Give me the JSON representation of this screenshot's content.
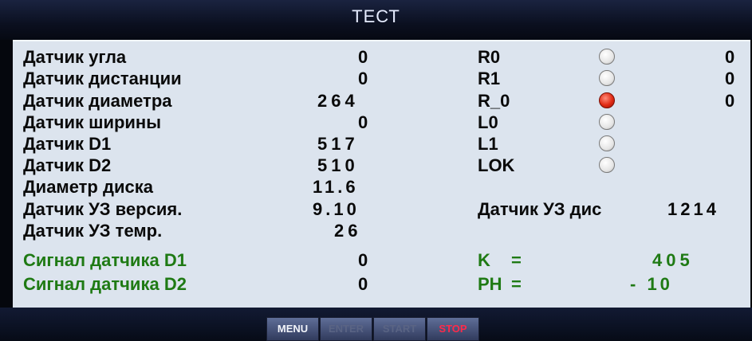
{
  "header": {
    "title": "ТЕСТ"
  },
  "sensors": [
    {
      "label": "Датчик угла",
      "value": "0"
    },
    {
      "label": "Датчик дистанции",
      "value": "0"
    },
    {
      "label": "Датчик диаметра",
      "value": "264"
    },
    {
      "label": "Датчик ширины",
      "value": "0"
    },
    {
      "label": "Датчик D1",
      "value": "517"
    },
    {
      "label": "Датчик D2",
      "value": "510"
    },
    {
      "label": "Диаметр диска",
      "value": "11.6"
    },
    {
      "label": "Датчик УЗ версия.",
      "value": "9.10"
    },
    {
      "label": "Датчик УЗ темр.",
      "value": "26"
    }
  ],
  "signals": [
    {
      "label": "Сигнал датчика D1",
      "value": "0"
    },
    {
      "label": "Сигнал датчика D2",
      "value": "0"
    }
  ],
  "indicators": [
    {
      "label": "R0",
      "state": "off",
      "value": "0"
    },
    {
      "label": "R1",
      "state": "off",
      "value": "0"
    },
    {
      "label": "R_0",
      "state": "on",
      "value": "0"
    },
    {
      "label": "L0",
      "state": "off"
    },
    {
      "label": "L1",
      "state": "off"
    },
    {
      "label": "LOK",
      "state": "off"
    }
  ],
  "uz_distance": {
    "label": "Датчик УЗ дис",
    "value": "1214"
  },
  "coefficients": [
    {
      "label": "K",
      "eq": "=",
      "value": "405"
    },
    {
      "label": "PH",
      "eq": "=",
      "value": "- 10"
    }
  ],
  "footer": {
    "buttons": [
      "MENU",
      "ENTER",
      "START",
      "STOP"
    ]
  },
  "colors": {
    "label_green": "#1f7a14",
    "led_on": "#e02a14",
    "stop": "#ff2a4a",
    "panel": "#dce4ee"
  }
}
